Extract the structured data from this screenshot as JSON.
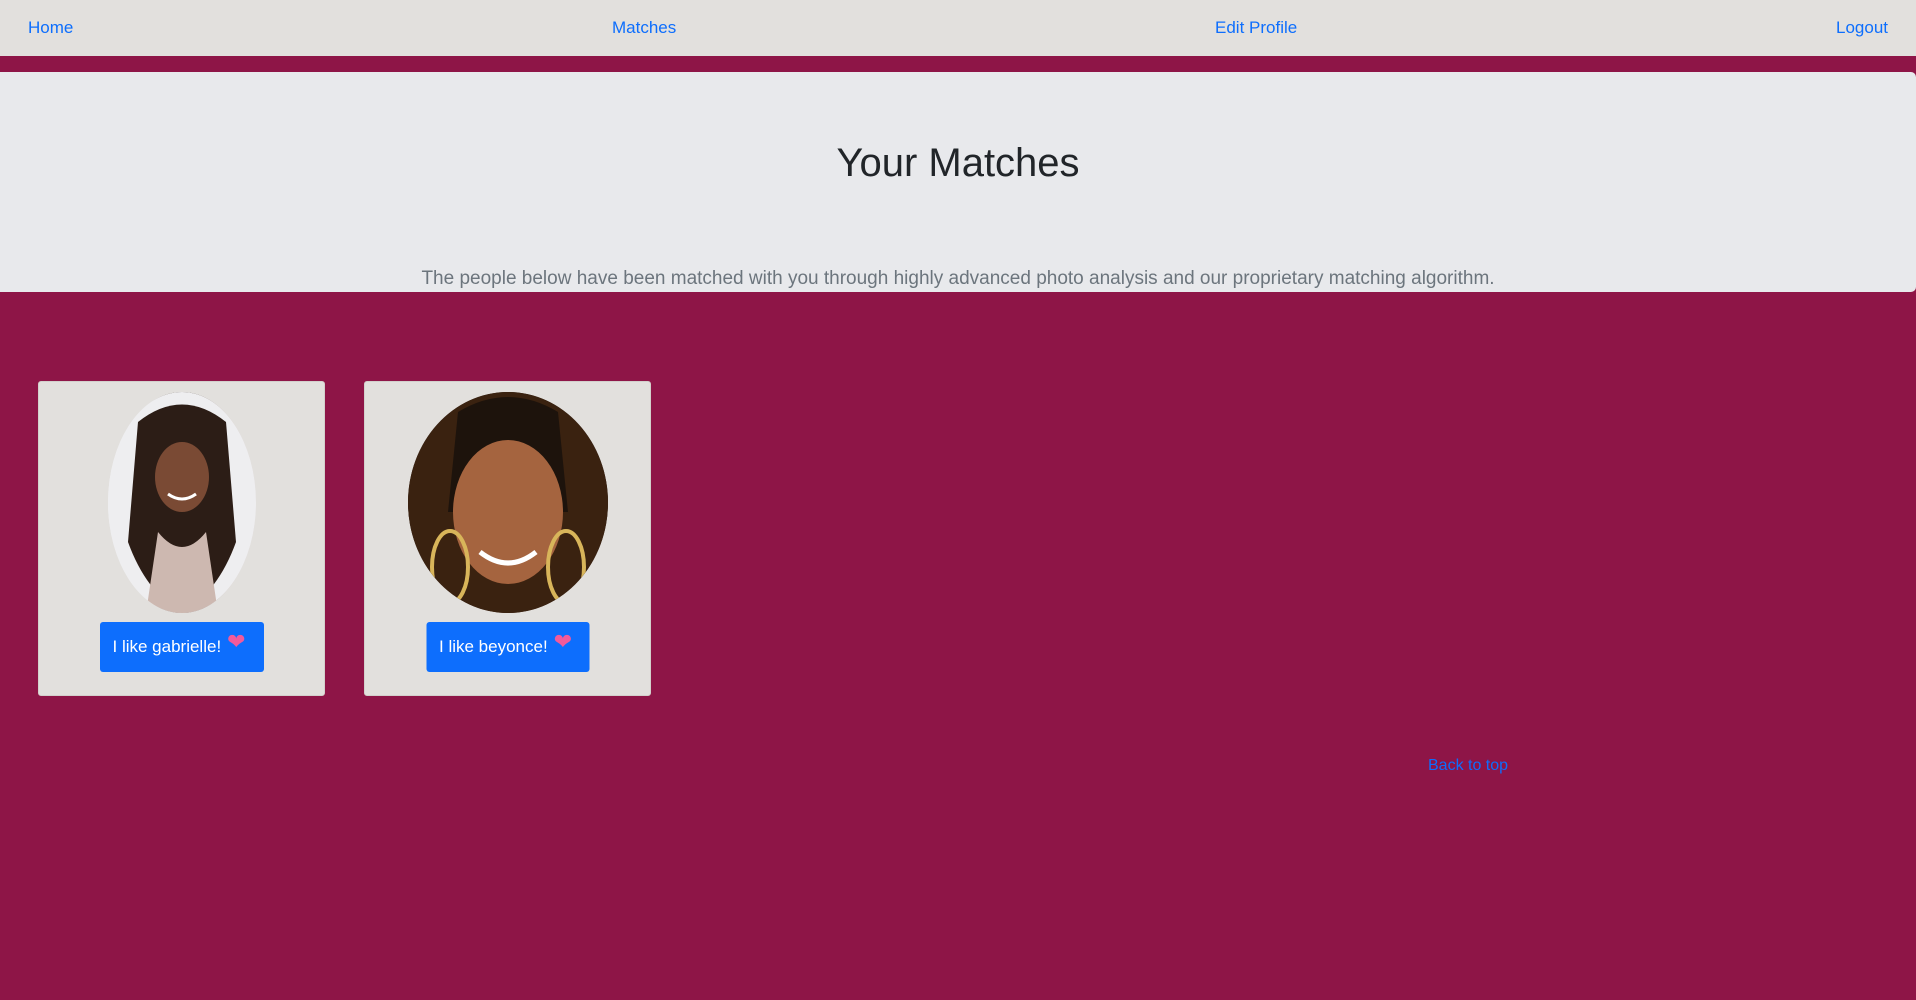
{
  "nav": {
    "home": "Home",
    "matches": "Matches",
    "edit_profile": "Edit Profile",
    "logout": "Logout"
  },
  "header": {
    "title": "Your Matches",
    "subtitle": "The people below have been matched with you through highly advanced photo analysis and our proprietary matching algorithm."
  },
  "matches": [
    {
      "button_label": "I like gabrielle!",
      "icon": "sparkling-heart-icon"
    },
    {
      "button_label": "I like beyonce!",
      "icon": "sparkling-heart-icon"
    }
  ],
  "footer": {
    "back_to_top": "Back to top"
  },
  "colors": {
    "page_background": "#8e1547",
    "navbar_background": "#e2e0dd",
    "jumbotron_background": "#e8e9ec",
    "card_background": "#e2e0dd",
    "button_background": "#0d6efd",
    "link": "#0d6efd"
  }
}
